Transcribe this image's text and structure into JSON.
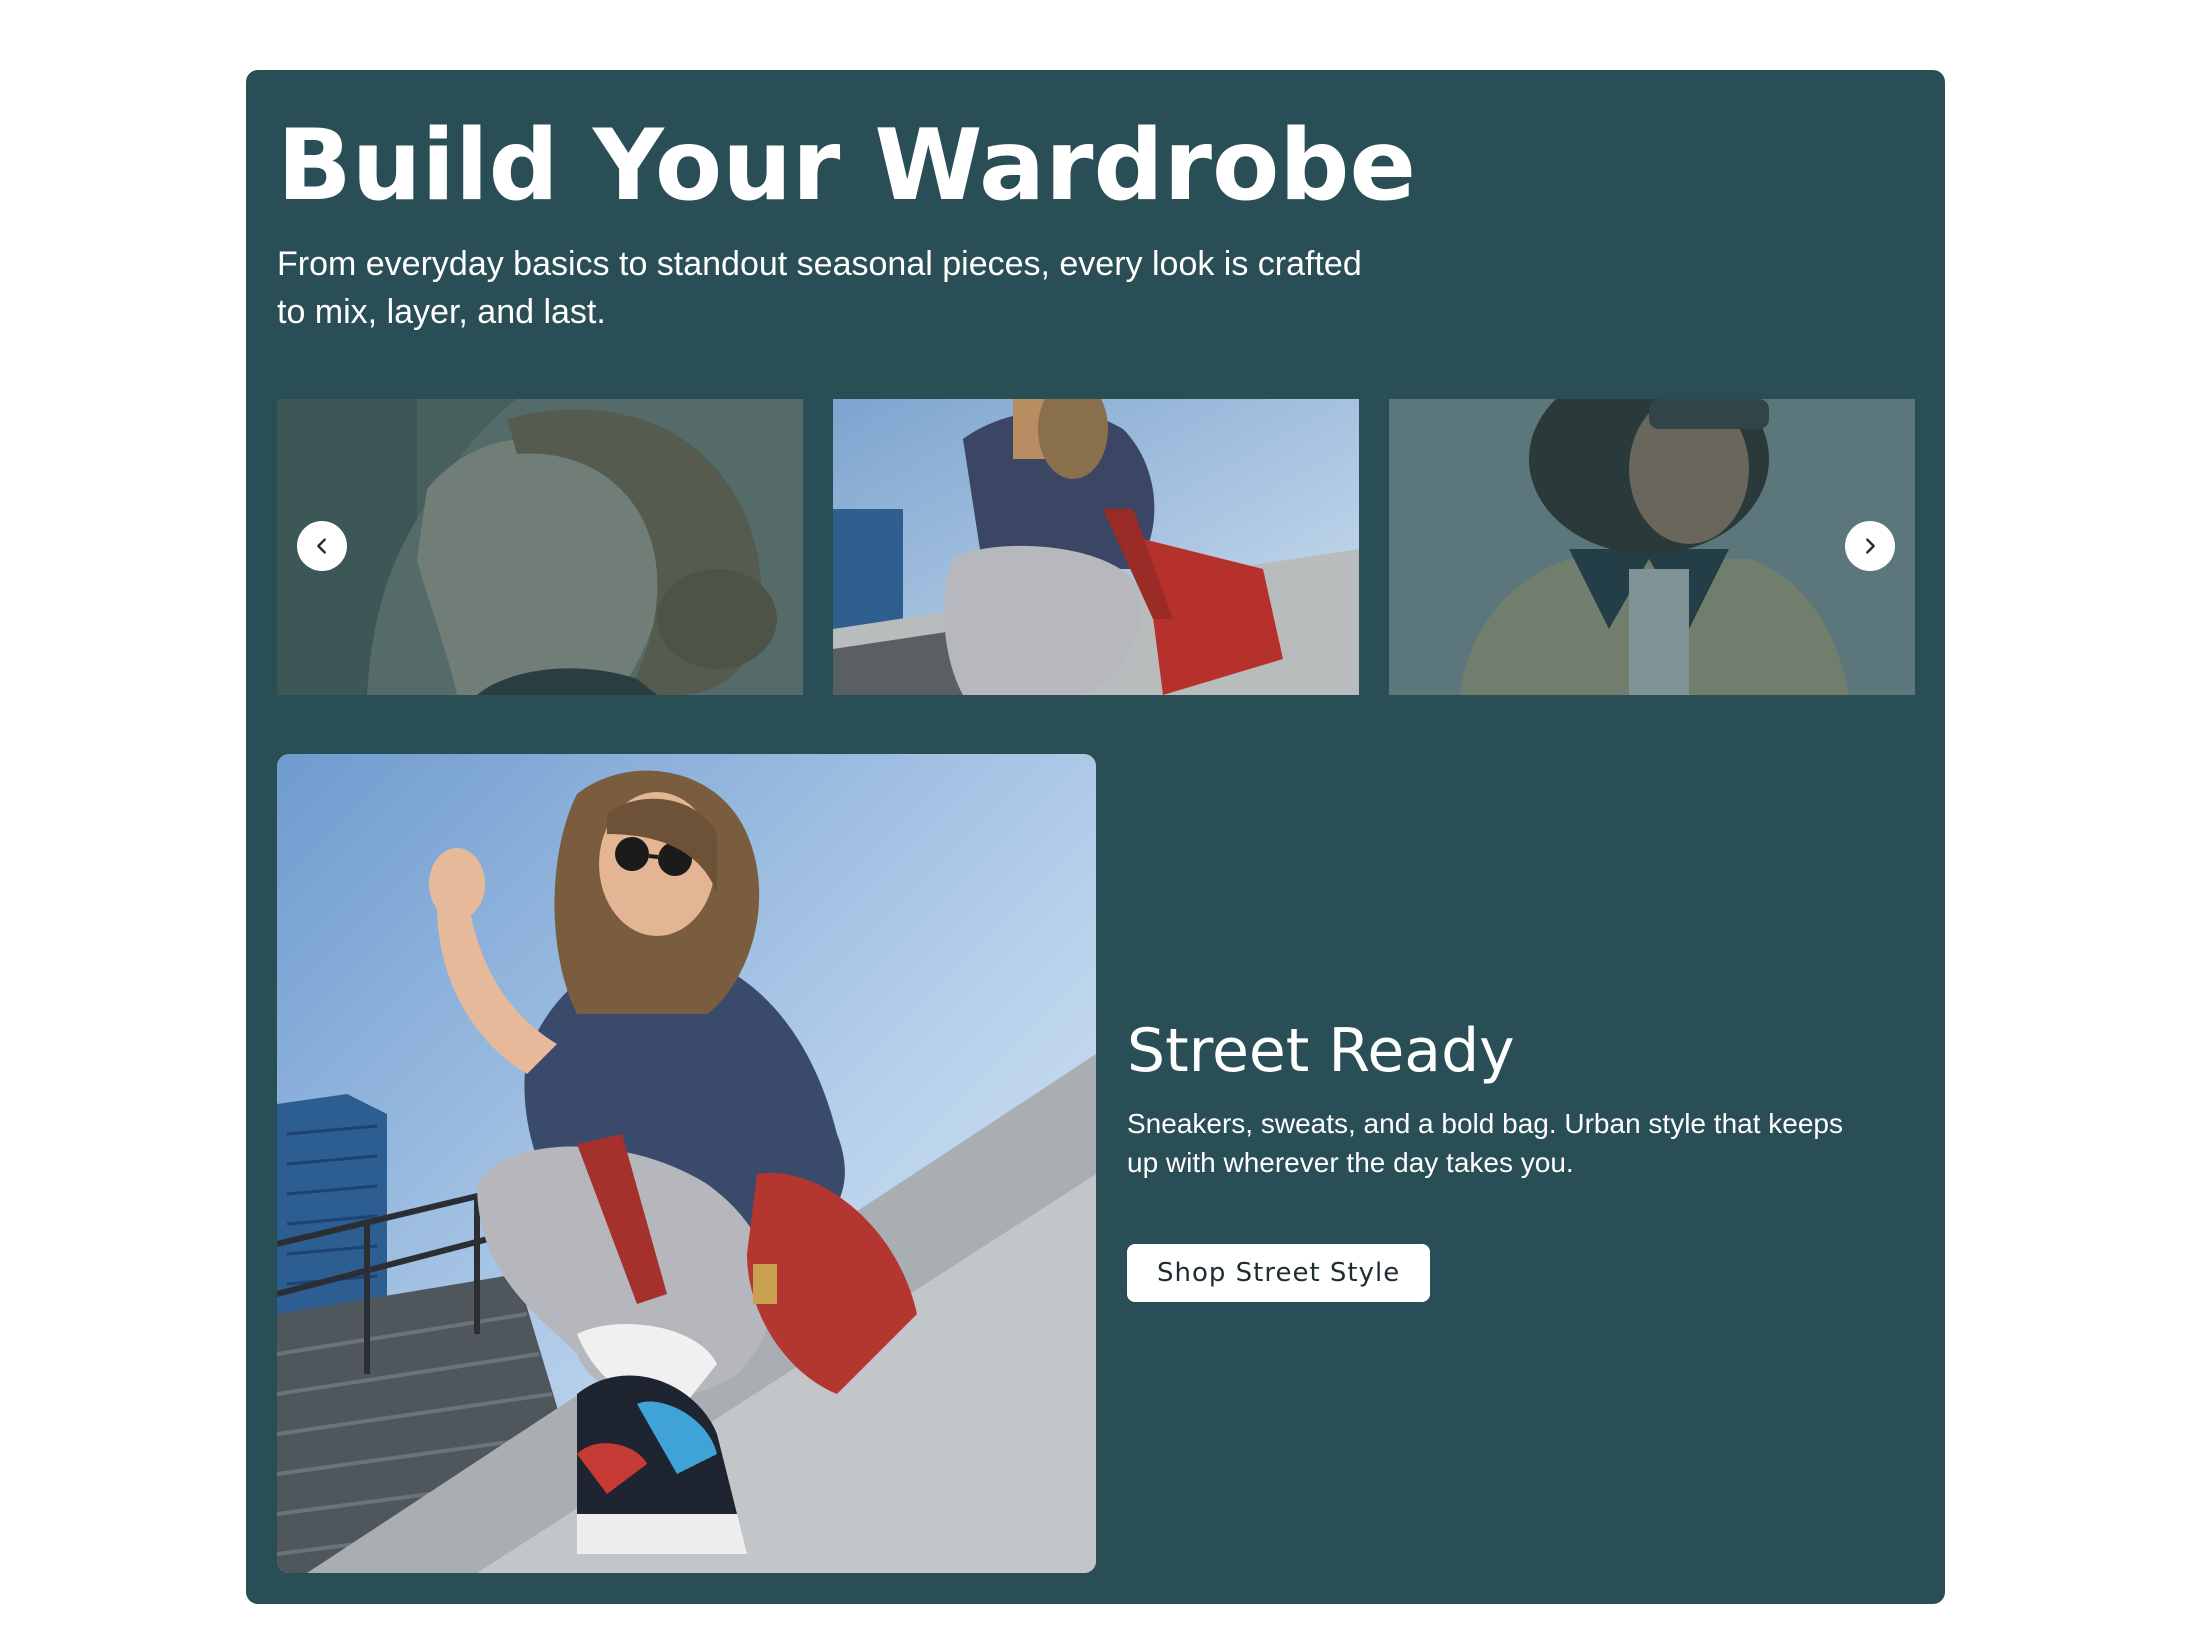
{
  "section": {
    "title": "Build Your Wardrobe",
    "subtitle": "From everyday basics to standout seasonal pieces, every look is crafted to mix, layer, and last."
  },
  "carousel": {
    "prev_icon": "chevron-left-icon",
    "next_icon": "chevron-right-icon",
    "slides": [
      {
        "image": "woman-profile-low-bun-photo",
        "active": false
      },
      {
        "image": "street-style-woman-red-bag-photo",
        "active": true
      },
      {
        "image": "curly-hair-woman-trench-coat-photo",
        "active": false
      }
    ]
  },
  "feature": {
    "image": "street-style-woman-red-bag-photo",
    "title": "Street Ready",
    "description": "Sneakers, sweats, and a bold bag. Urban style that keeps up with wherever the day takes you.",
    "cta_label": "Shop Street Style"
  },
  "colors": {
    "panel_bg": "#2a4e55",
    "text": "#ffffff",
    "button_bg": "#ffffff",
    "button_text": "#1d2d30"
  }
}
